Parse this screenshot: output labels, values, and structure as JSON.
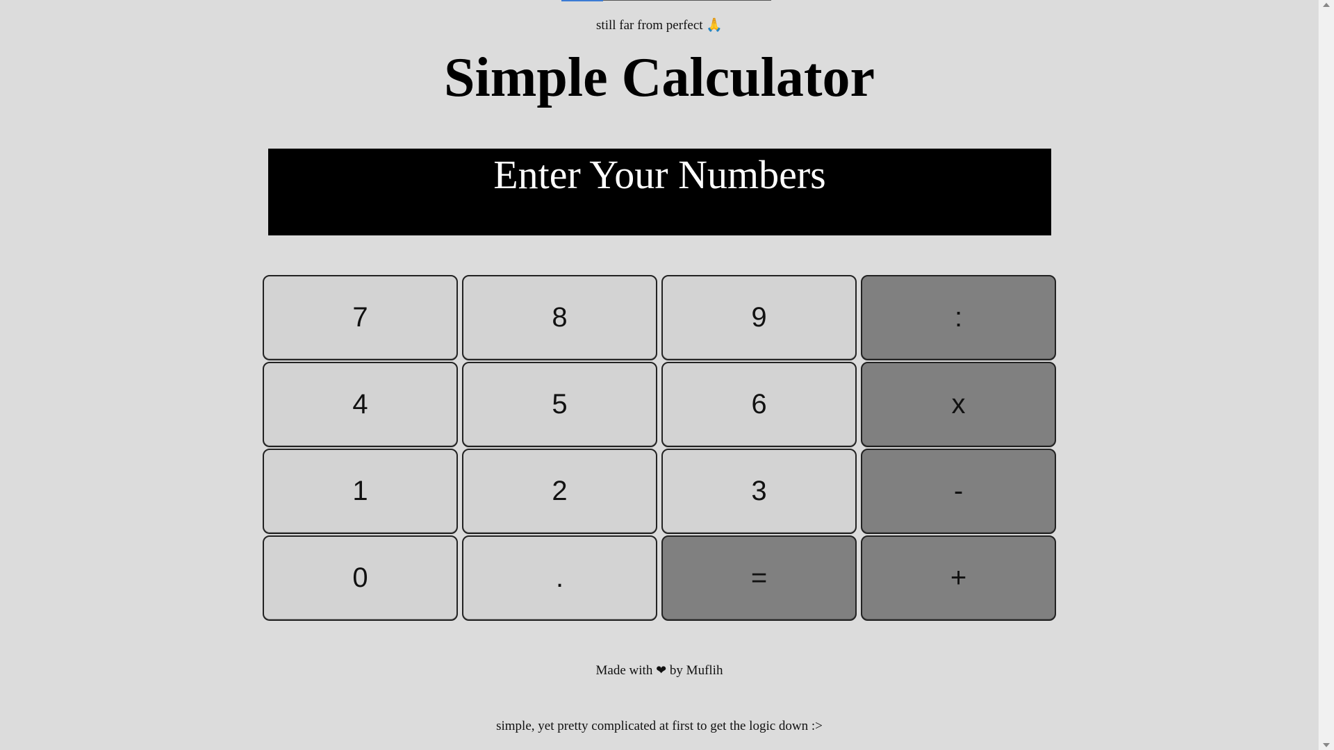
{
  "header": {
    "subtitle": "still far from perfect 🙏",
    "title": "Simple Calculator"
  },
  "display": {
    "text": "Enter Your Numbers"
  },
  "keypad": {
    "keys": [
      {
        "label": "7",
        "type": "digit"
      },
      {
        "label": "8",
        "type": "digit"
      },
      {
        "label": "9",
        "type": "digit"
      },
      {
        "label": ":",
        "type": "operator"
      },
      {
        "label": "4",
        "type": "digit"
      },
      {
        "label": "5",
        "type": "digit"
      },
      {
        "label": "6",
        "type": "digit"
      },
      {
        "label": "x",
        "type": "operator"
      },
      {
        "label": "1",
        "type": "digit"
      },
      {
        "label": "2",
        "type": "digit"
      },
      {
        "label": "3",
        "type": "digit"
      },
      {
        "label": "-",
        "type": "operator"
      },
      {
        "label": "0",
        "type": "digit"
      },
      {
        "label": ".",
        "type": "digit"
      },
      {
        "label": "=",
        "type": "operator"
      },
      {
        "label": "+",
        "type": "operator"
      }
    ]
  },
  "footer": {
    "made_with_prefix": "Made with",
    "heart_icon": "heart-icon",
    "made_with_suffix": "by Muflih",
    "tagline": "simple, yet pretty complicated at first to get the logic down :>"
  },
  "colors": {
    "background": "#dcdcdc",
    "display_bg": "#000000",
    "display_text": "#ffffff",
    "digit_key": "#d3d3d3",
    "operator_key": "#808080"
  }
}
